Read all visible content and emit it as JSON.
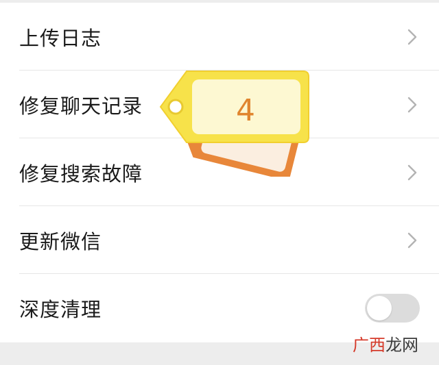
{
  "settings": {
    "items": [
      {
        "label": "上传日志",
        "control": "chevron"
      },
      {
        "label": "修复聊天记录",
        "control": "chevron"
      },
      {
        "label": "修复搜索故障",
        "control": "chevron"
      },
      {
        "label": "更新微信",
        "control": "chevron"
      },
      {
        "label": "深度清理",
        "control": "toggle",
        "enabled": false
      }
    ]
  },
  "overlay": {
    "tag_number": "4",
    "tag_colors": {
      "front": "#f7e24a",
      "back": "#e8873a",
      "inner": "#fdf8d2"
    }
  },
  "watermark": {
    "part1": "广西",
    "part2": "龙网"
  },
  "colors": {
    "background": "#ededed",
    "panel": "#ffffff",
    "text": "#1a1a1a",
    "chevron": "#b3b3b3",
    "toggle_off": "#dcdcdc"
  }
}
